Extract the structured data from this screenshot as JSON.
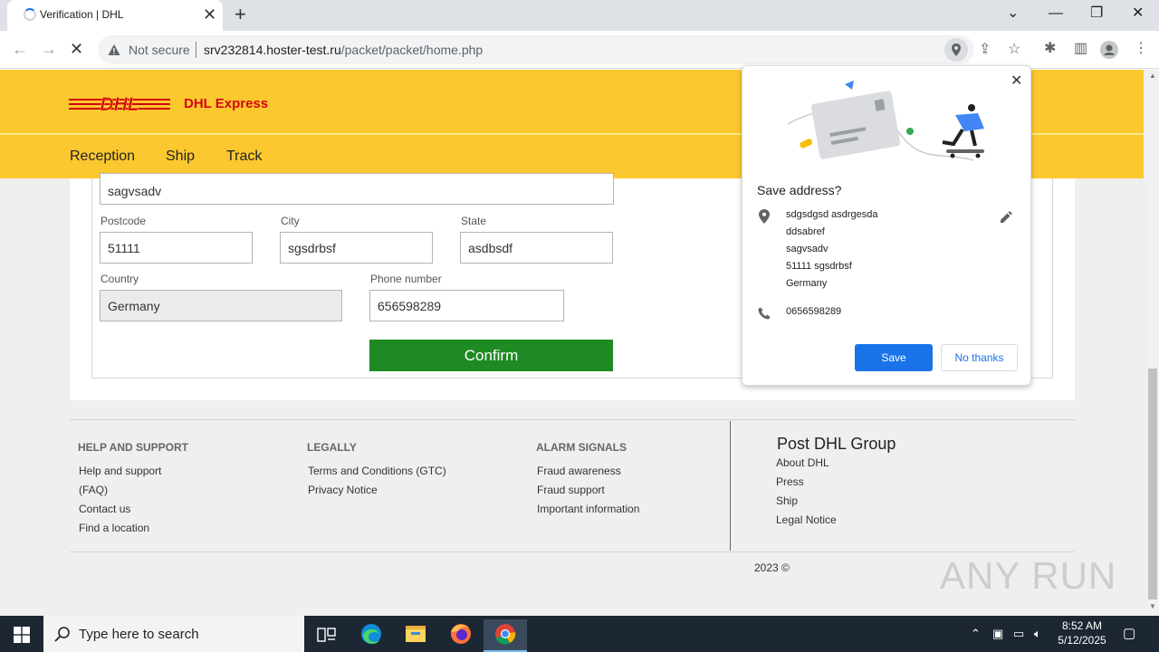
{
  "browser": {
    "tab_title": "Verification | DHL",
    "tab_close": "✕",
    "new_tab": "+",
    "address": {
      "security_label": "Not secure",
      "url_host": "srv232814.hoster-test.ru",
      "url_path": "/packet/packet/home.php"
    }
  },
  "header": {
    "logo_text": "DHL",
    "express_label": "DHL Express",
    "nav": [
      "Reception",
      "Ship",
      "Track"
    ]
  },
  "form": {
    "address_value": "sagvsadv",
    "postcode_label": "Postcode",
    "postcode_value": "51111",
    "city_label": "City",
    "city_value": "sgsdrbsf",
    "state_label": "State",
    "state_value": "asdbsdf",
    "country_label": "Country",
    "country_value": "Germany",
    "phone_label": "Phone number",
    "phone_value": "656598289",
    "confirm_label": "Confirm"
  },
  "footer": {
    "columns": [
      {
        "title": "HELP AND SUPPORT",
        "links": [
          "Help and support",
          "(FAQ)",
          "Contact us",
          "Find a location"
        ]
      },
      {
        "title": "LEGALLY",
        "links": [
          "Terms and Conditions (GTC)",
          "Privacy Notice"
        ]
      },
      {
        "title": "ALARM SIGNALS",
        "links": [
          "Fraud awareness",
          "Fraud support",
          "Important information"
        ]
      }
    ],
    "group_title": "Post DHL Group",
    "group_links": [
      "About DHL",
      "Press",
      "Ship",
      "Legal Notice"
    ],
    "copyright": "2023 ©"
  },
  "popup": {
    "title": "Save address?",
    "address_lines": [
      "sdgsdgsd asdrgesda",
      "ddsabref",
      "sagvsadv",
      "51111 sgsdrbsf",
      "Germany"
    ],
    "phone": "0656598289",
    "save_label": "Save",
    "no_thanks_label": "No thanks"
  },
  "watermark": "ANY RUN",
  "taskbar": {
    "search_placeholder": "Type here to search",
    "time": "8:52 AM",
    "date": "5/12/2025"
  },
  "colors": {
    "dhl_yellow": "#fcc82f",
    "dhl_red": "#d40511",
    "confirm_green": "#1f8a23",
    "chrome_blue": "#1a73e8"
  }
}
